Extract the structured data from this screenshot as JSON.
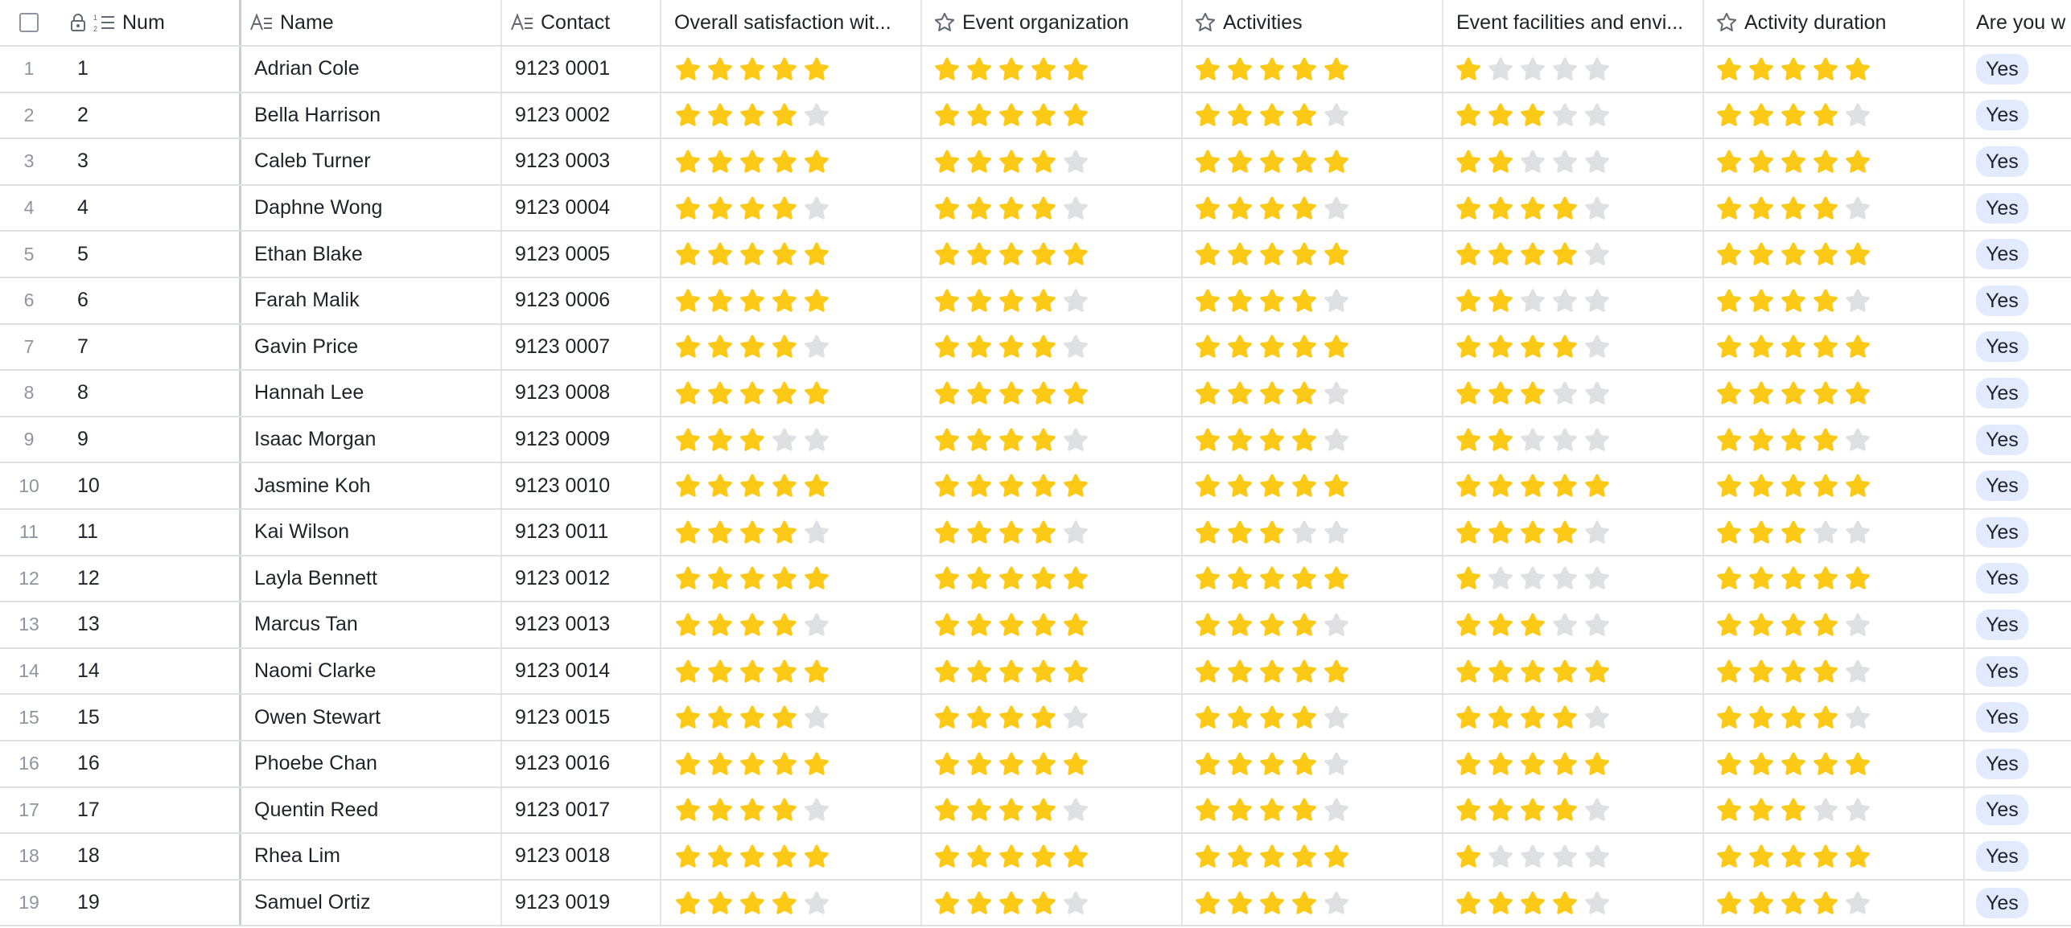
{
  "columns": {
    "num": "Num",
    "name": "Name",
    "contact": "Contact",
    "overall": "Overall satisfaction wit...",
    "organization": "Event organization",
    "activities": "Activities",
    "facilities": "Event facilities and envi...",
    "duration": "Activity duration",
    "attend": "Are you w"
  },
  "colors": {
    "star_filled": "#fbc916",
    "star_empty": "#dee0e3",
    "tag_bg": "#e1eaff"
  },
  "rows": [
    {
      "row": "1",
      "num": "1",
      "name": "Adrian Cole",
      "contact": "9123 0001",
      "overall": 5,
      "organization": 5,
      "activities": 5,
      "facilities": 1,
      "duration": 5,
      "attend": "Yes"
    },
    {
      "row": "2",
      "num": "2",
      "name": "Bella Harrison",
      "contact": "9123 0002",
      "overall": 4,
      "organization": 5,
      "activities": 4,
      "facilities": 3,
      "duration": 4,
      "attend": "Yes"
    },
    {
      "row": "3",
      "num": "3",
      "name": "Caleb Turner",
      "contact": "9123 0003",
      "overall": 5,
      "organization": 4,
      "activities": 5,
      "facilities": 2,
      "duration": 5,
      "attend": "Yes"
    },
    {
      "row": "4",
      "num": "4",
      "name": "Daphne Wong",
      "contact": "9123 0004",
      "overall": 4,
      "organization": 4,
      "activities": 4,
      "facilities": 4,
      "duration": 4,
      "attend": "Yes"
    },
    {
      "row": "5",
      "num": "5",
      "name": "Ethan Blake",
      "contact": "9123 0005",
      "overall": 5,
      "organization": 5,
      "activities": 5,
      "facilities": 4,
      "duration": 5,
      "attend": "Yes"
    },
    {
      "row": "6",
      "num": "6",
      "name": "Farah Malik",
      "contact": "9123 0006",
      "overall": 5,
      "organization": 4,
      "activities": 4,
      "facilities": 2,
      "duration": 4,
      "attend": "Yes"
    },
    {
      "row": "7",
      "num": "7",
      "name": "Gavin Price",
      "contact": "9123 0007",
      "overall": 4,
      "organization": 4,
      "activities": 5,
      "facilities": 4,
      "duration": 5,
      "attend": "Yes"
    },
    {
      "row": "8",
      "num": "8",
      "name": "Hannah Lee",
      "contact": "9123 0008",
      "overall": 5,
      "organization": 5,
      "activities": 4,
      "facilities": 3,
      "duration": 5,
      "attend": "Yes"
    },
    {
      "row": "9",
      "num": "9",
      "name": "Isaac Morgan",
      "contact": "9123 0009",
      "overall": 3,
      "organization": 4,
      "activities": 4,
      "facilities": 2,
      "duration": 4,
      "attend": "Yes"
    },
    {
      "row": "10",
      "num": "10",
      "name": "Jasmine Koh",
      "contact": "9123 0010",
      "overall": 5,
      "organization": 5,
      "activities": 5,
      "facilities": 5,
      "duration": 5,
      "attend": "Yes"
    },
    {
      "row": "11",
      "num": "11",
      "name": "Kai Wilson",
      "contact": "9123 0011",
      "overall": 4,
      "organization": 4,
      "activities": 3,
      "facilities": 4,
      "duration": 3,
      "attend": "Yes"
    },
    {
      "row": "12",
      "num": "12",
      "name": "Layla Bennett",
      "contact": "9123 0012",
      "overall": 5,
      "organization": 5,
      "activities": 5,
      "facilities": 1,
      "duration": 5,
      "attend": "Yes"
    },
    {
      "row": "13",
      "num": "13",
      "name": "Marcus Tan",
      "contact": "9123 0013",
      "overall": 4,
      "organization": 5,
      "activities": 4,
      "facilities": 3,
      "duration": 4,
      "attend": "Yes"
    },
    {
      "row": "14",
      "num": "14",
      "name": "Naomi Clarke",
      "contact": "9123 0014",
      "overall": 5,
      "organization": 5,
      "activities": 5,
      "facilities": 5,
      "duration": 4,
      "attend": "Yes"
    },
    {
      "row": "15",
      "num": "15",
      "name": "Owen Stewart",
      "contact": "9123 0015",
      "overall": 4,
      "organization": 4,
      "activities": 4,
      "facilities": 4,
      "duration": 4,
      "attend": "Yes"
    },
    {
      "row": "16",
      "num": "16",
      "name": "Phoebe Chan",
      "contact": "9123 0016",
      "overall": 5,
      "organization": 5,
      "activities": 4,
      "facilities": 5,
      "duration": 5,
      "attend": "Yes"
    },
    {
      "row": "17",
      "num": "17",
      "name": "Quentin Reed",
      "contact": "9123 0017",
      "overall": 4,
      "organization": 4,
      "activities": 4,
      "facilities": 4,
      "duration": 3,
      "attend": "Yes"
    },
    {
      "row": "18",
      "num": "18",
      "name": "Rhea Lim",
      "contact": "9123 0018",
      "overall": 5,
      "organization": 5,
      "activities": 5,
      "facilities": 1,
      "duration": 5,
      "attend": "Yes"
    },
    {
      "row": "19",
      "num": "19",
      "name": "Samuel Ortiz",
      "contact": "9123 0019",
      "overall": 4,
      "organization": 4,
      "activities": 4,
      "facilities": 4,
      "duration": 4,
      "attend": "Yes"
    }
  ]
}
